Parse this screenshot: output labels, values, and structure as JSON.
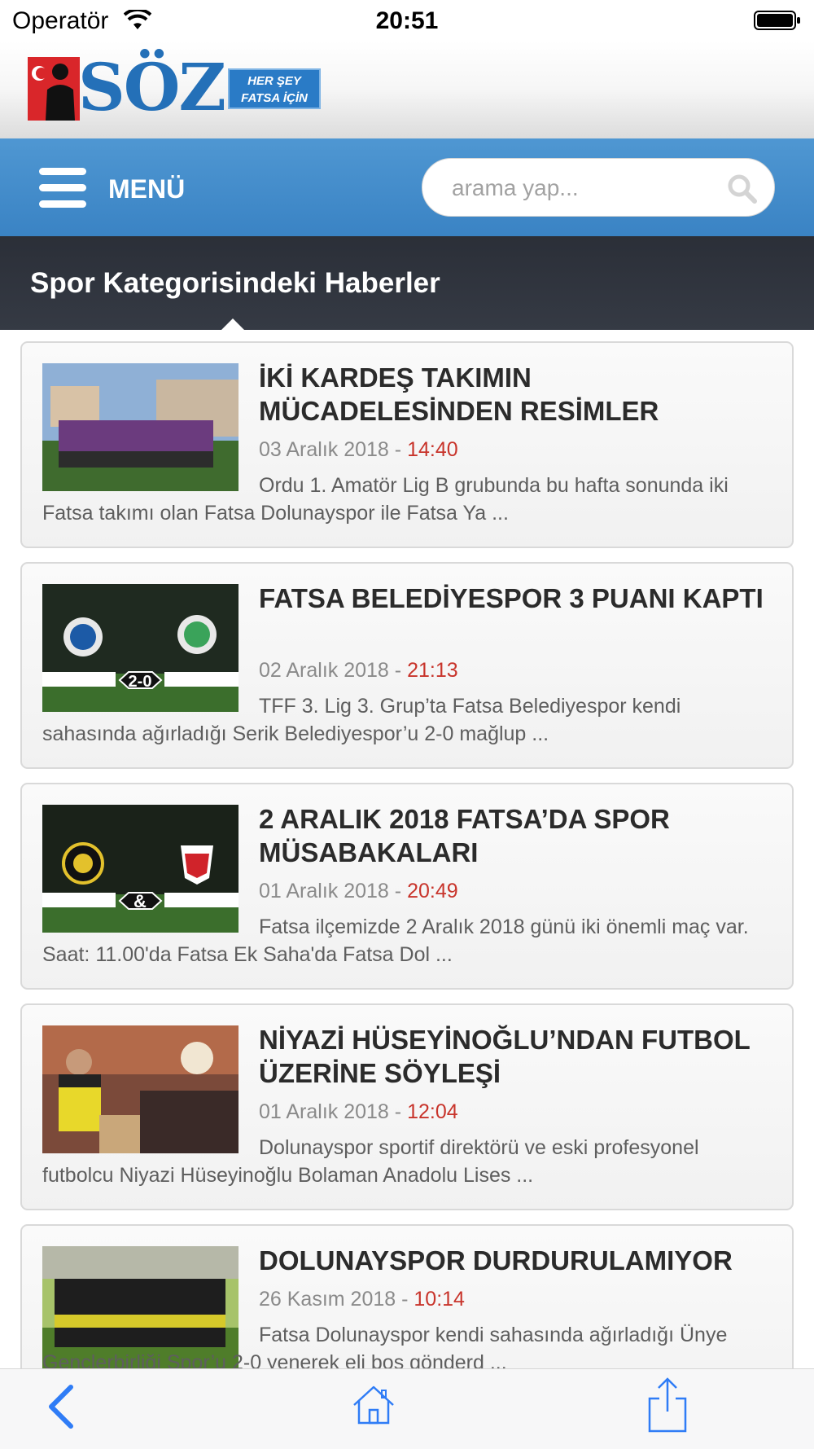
{
  "status_bar": {
    "carrier": "Operatör",
    "time": "20:51"
  },
  "header": {
    "logo_text": "SÖZ",
    "logo_tagline_1": "HER ŞEY",
    "logo_tagline_2": "FATSA İÇİN"
  },
  "nav": {
    "menu_label": "MENÜ",
    "search_placeholder": "arama yap..."
  },
  "section": {
    "title": "Spor Kategorisindeki Haberler"
  },
  "news": [
    {
      "title": "İKİ KARDEŞ TAKIMIN MÜCADELESİNDEN RESİMLER",
      "date": "03 Aralık 2018 - ",
      "time": "14:40",
      "excerpt": "Ordu 1. Amatör Lig B grubunda bu hafta sonunda iki Fatsa takımı olan Fatsa Dolunayspor ile Fatsa Ya ..."
    },
    {
      "title": "FATSA BELEDİYESPOR 3 PUANI KAPTI",
      "date": "02 Aralık 2018 - ",
      "time": "21:13",
      "excerpt": "TFF 3. Lig 3. Grup’ta Fatsa Belediyespor kendi sahasında ağırladığı Serik Belediyespor’u 2-0 mağlup ..."
    },
    {
      "title": "2 ARALIK 2018 FATSA’DA SPOR MÜSABAKALARI",
      "date": "01 Aralık 2018 - ",
      "time": "20:49",
      "excerpt": "Fatsa ilçemizde 2 Aralık 2018 günü iki önemli maç var. Saat: 11.00'da Fatsa Ek Saha'da Fatsa Dol ..."
    },
    {
      "title": "NİYAZİ HÜSEYİNOĞLU’NDAN FUTBOL ÜZERİNE SÖYLEŞİ",
      "date": "01 Aralık 2018 - ",
      "time": "12:04",
      "excerpt": "Dolunayspor sportif direktörü ve eski profesyonel futbolcu Niyazi Hüseyinoğlu Bolaman Anadolu Lises ..."
    },
    {
      "title": "DOLUNAYSPOR DURDURULAMIYOR",
      "date": "26 Kasım 2018 - ",
      "time": "10:14",
      "excerpt": "Fatsa Dolunayspor kendi sahasında ağırladığı Ünye Gençlerbirliği Spor’u 2-0 yenerek eli boş gönderd ..."
    }
  ],
  "thumb_texts": {
    "score": "2-0",
    "amp": "&"
  },
  "toolbar": {
    "back": "chevron-left-icon",
    "home": "home-icon",
    "share": "share-icon"
  },
  "colors": {
    "accent": "#3a83c4",
    "time": "#c8342b",
    "dark_bar": "#2f333c"
  }
}
